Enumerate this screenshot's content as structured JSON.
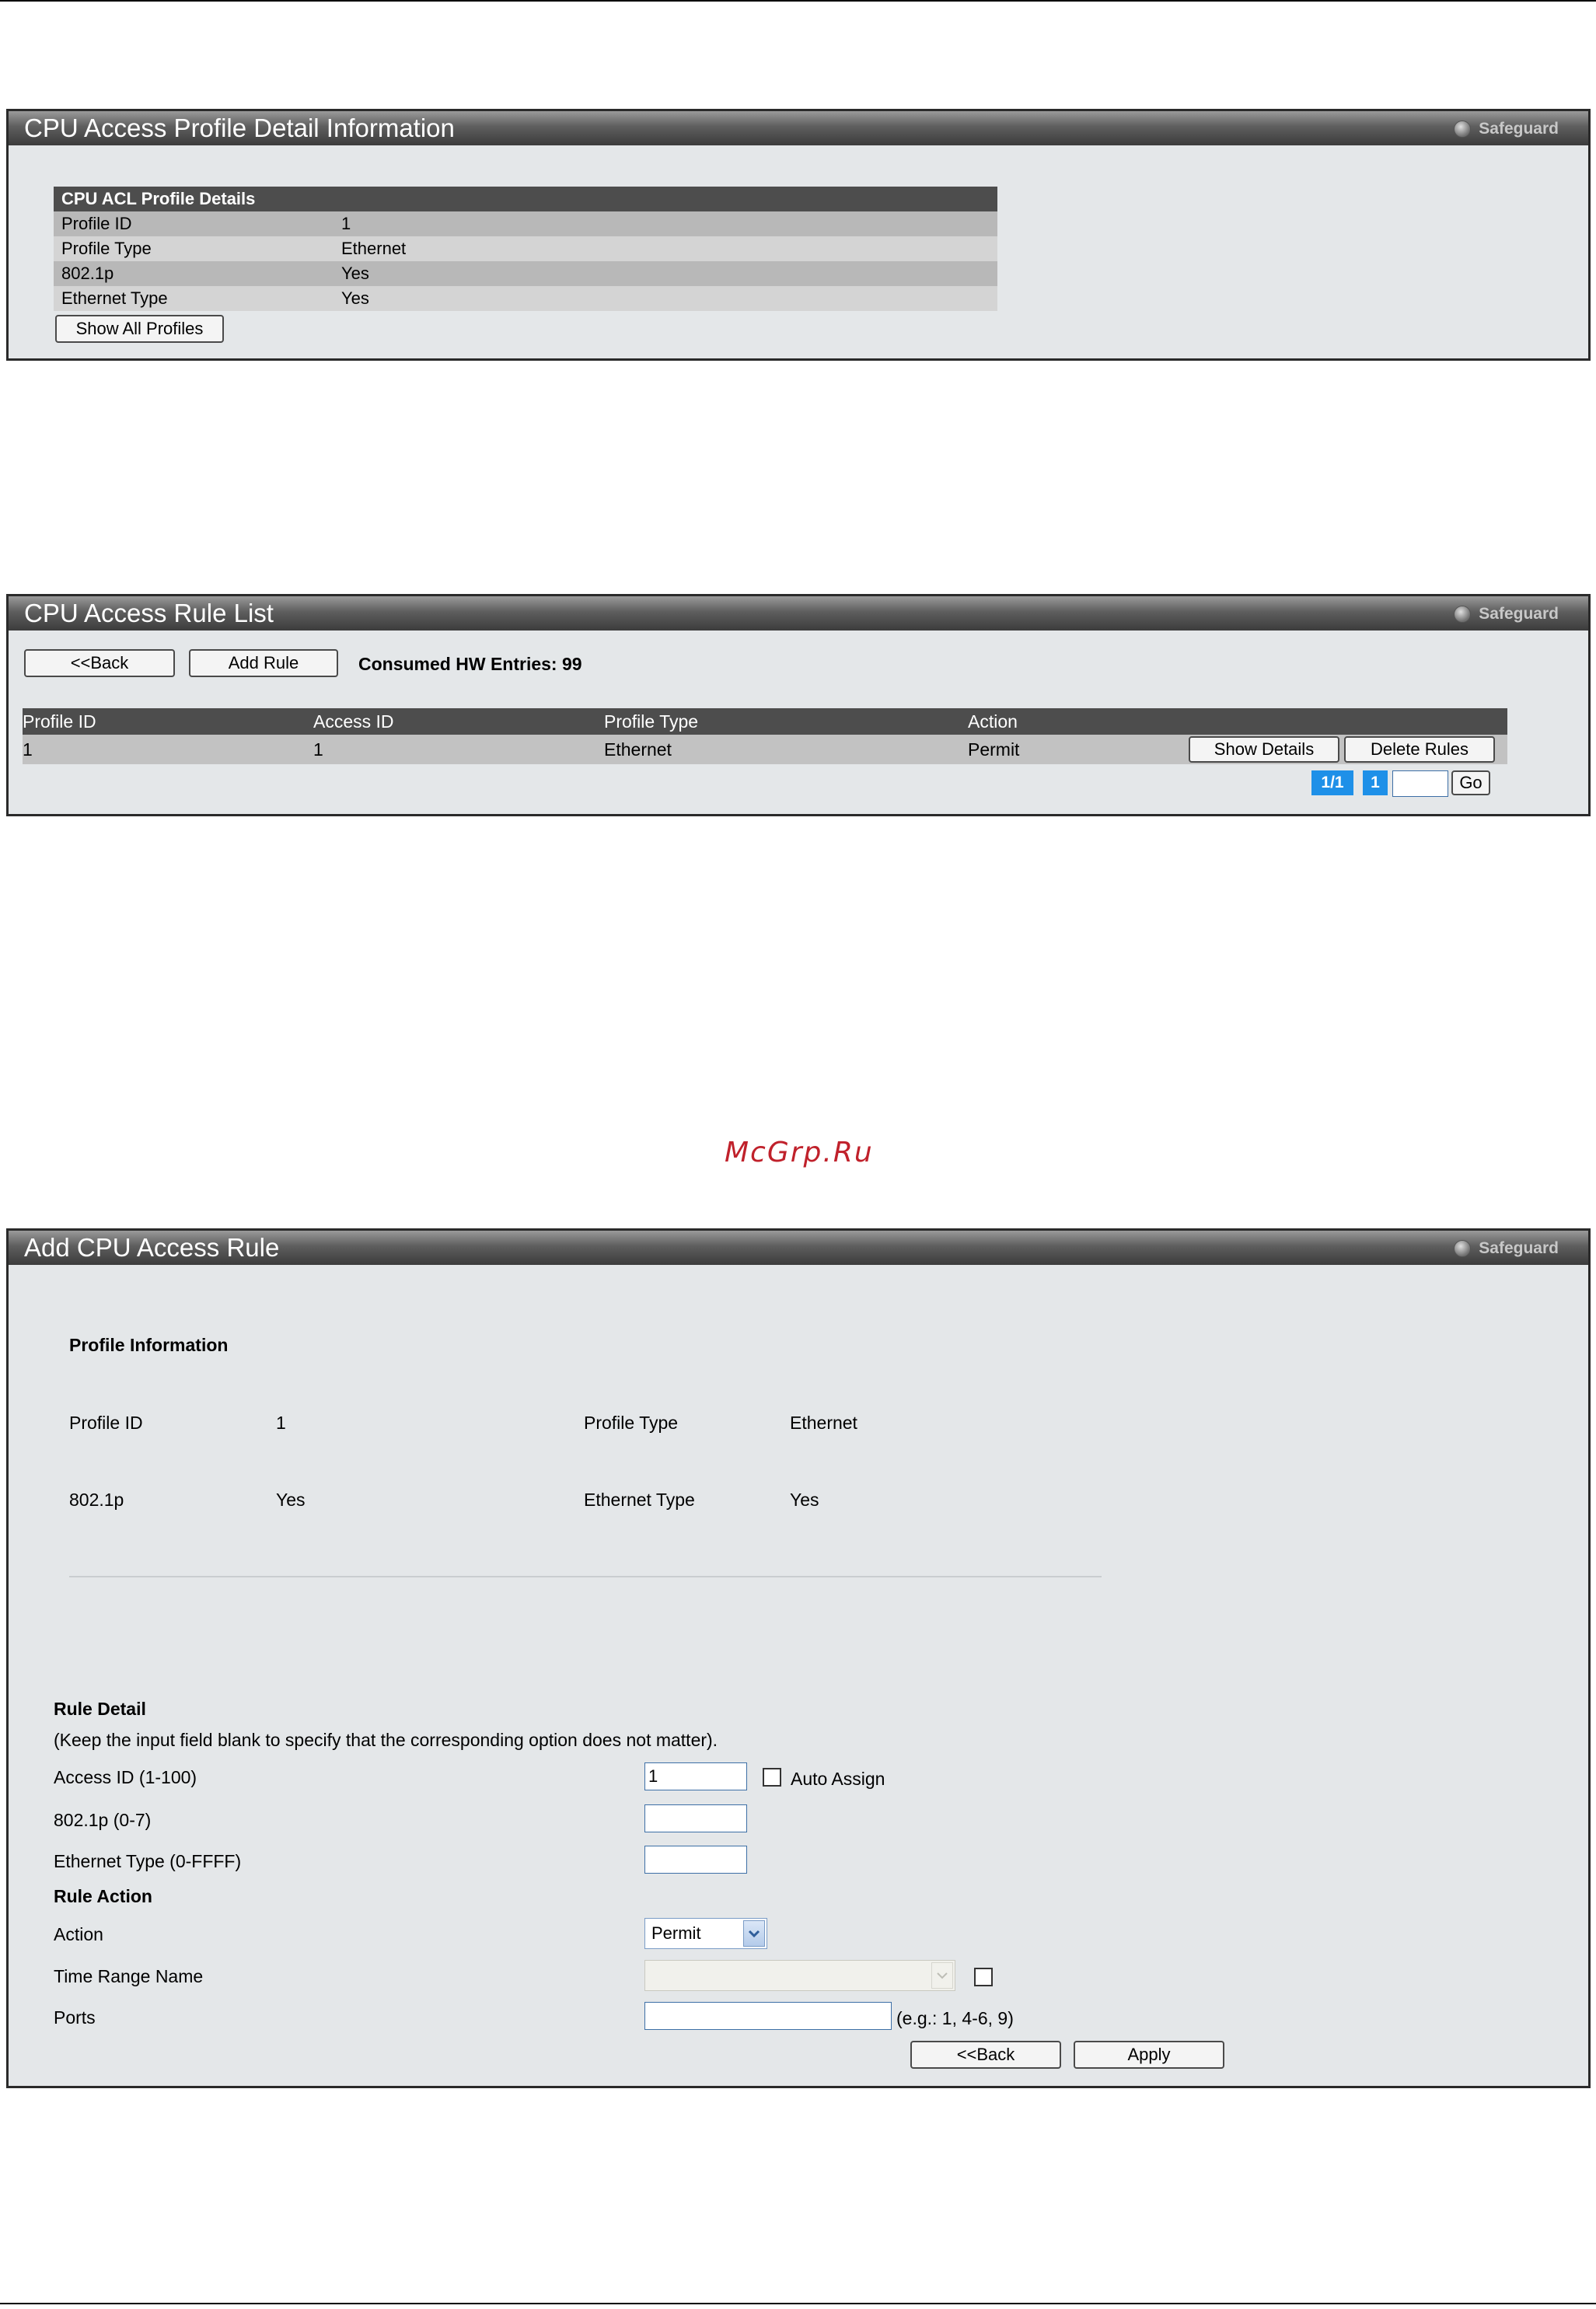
{
  "panel1": {
    "title": "CPU Access Profile Detail Information",
    "safeguard": "Safeguard",
    "table_header": "CPU ACL Profile Details",
    "rows": [
      {
        "label": "Profile ID",
        "value": "1"
      },
      {
        "label": "Profile Type",
        "value": "Ethernet"
      },
      {
        "label": "802.1p",
        "value": "Yes"
      },
      {
        "label": "Ethernet Type",
        "value": "Yes"
      }
    ],
    "show_all_button": "Show All Profiles"
  },
  "panel2": {
    "title": "CPU Access Rule List",
    "safeguard": "Safeguard",
    "back_button": "<<Back",
    "add_rule_button": "Add Rule",
    "consumed_entries": "Consumed HW Entries: 99",
    "columns": [
      "Profile ID",
      "Access ID",
      "Profile Type",
      "Action"
    ],
    "rows": [
      {
        "profile_id": "1",
        "access_id": "1",
        "profile_type": "Ethernet",
        "action": "Permit"
      }
    ],
    "show_details_button": "Show Details",
    "delete_rules_button": "Delete Rules",
    "pagination": {
      "page_of": "1/1",
      "current_page": "1",
      "page_input": "",
      "go_button": "Go"
    }
  },
  "watermark": "McGrp.Ru",
  "panel3": {
    "title": "Add CPU Access Rule",
    "safeguard": "Safeguard",
    "profile_info_heading": "Profile Information",
    "profile_info": {
      "profile_id_label": "Profile ID",
      "profile_id_value": "1",
      "profile_type_label": "Profile Type",
      "profile_type_value": "Ethernet",
      "dot1p_label": "802.1p",
      "dot1p_value": "Yes",
      "ethernet_type_label": "Ethernet Type",
      "ethernet_type_value": "Yes"
    },
    "rule_detail_heading": "Rule Detail",
    "rule_detail_note": "(Keep the input field blank to specify that the corresponding option does not matter).",
    "access_id_label": "Access ID (1-100)",
    "access_id_value": "1",
    "auto_assign_label": "Auto Assign",
    "dot1p_field_label": "802.1p  (0-7)",
    "dot1p_field_value": "",
    "ethernet_type_field_label": "Ethernet Type  (0-FFFF)",
    "ethernet_type_field_value": "",
    "rule_action_heading": "Rule Action",
    "action_label": "Action",
    "action_value": "Permit",
    "time_range_label": "Time Range Name",
    "time_range_value": "",
    "ports_label": "Ports",
    "ports_value": "",
    "ports_hint": "(e.g.: 1, 4-6, 9)",
    "back_button": "<<Back",
    "apply_button": "Apply"
  },
  "colors": {
    "panel_bg": "#e4e7e9",
    "table_header": "#4d4d4d",
    "page_badge": "#1e90e8",
    "watermark": "#c0212b"
  }
}
